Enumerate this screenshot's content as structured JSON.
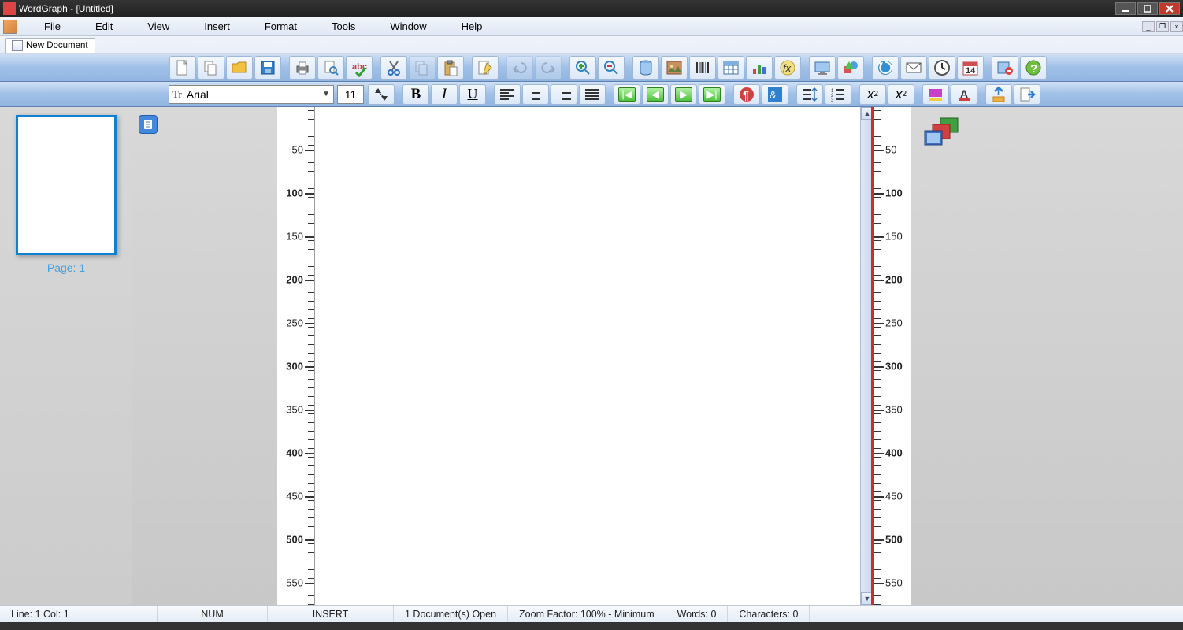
{
  "title_bar": {
    "text": "WordGraph - [Untitled]"
  },
  "menus": {
    "file": "File",
    "edit": "Edit",
    "view": "View",
    "insert": "Insert",
    "format": "Format",
    "tools": "Tools",
    "window": "Window",
    "help": "Help"
  },
  "doc_tab": {
    "label": "New Document"
  },
  "font": {
    "name": "Arial",
    "size": "11"
  },
  "format_buttons": {
    "bold": "B",
    "italic": "I",
    "underline": "U"
  },
  "ruler": {
    "marks": [
      {
        "value": "50",
        "major": false
      },
      {
        "value": "100",
        "major": true
      },
      {
        "value": "150",
        "major": false
      },
      {
        "value": "200",
        "major": true
      },
      {
        "value": "250",
        "major": false
      },
      {
        "value": "300",
        "major": true
      },
      {
        "value": "350",
        "major": false
      },
      {
        "value": "400",
        "major": true
      },
      {
        "value": "450",
        "major": false
      },
      {
        "value": "500",
        "major": true
      },
      {
        "value": "550",
        "major": false
      }
    ]
  },
  "thumbnail": {
    "page_label": "Page: 1"
  },
  "calendar_day": "14",
  "status": {
    "line_col": "Line:  1  Col:  1",
    "num": "NUM",
    "insert": "INSERT",
    "docs_open": "1 Document(s) Open",
    "zoom": "Zoom Factor: 100% - Minimum",
    "words": "Words: 0",
    "chars": "Characters: 0"
  }
}
